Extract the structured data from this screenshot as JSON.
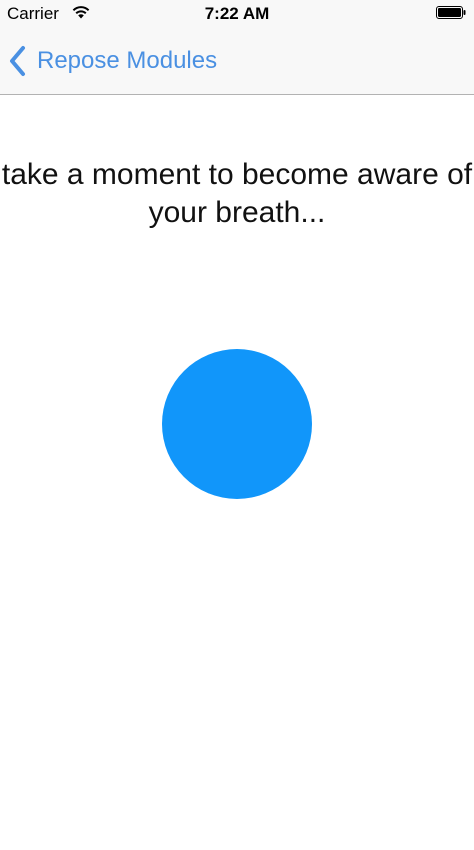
{
  "status_bar": {
    "carrier": "Carrier",
    "time": "7:22 AM",
    "wifi_icon": "wifi-icon",
    "battery_icon": "battery-icon"
  },
  "nav": {
    "back_label": "Repose Modules",
    "back_icon": "chevron-left-icon",
    "accent_color": "#4a90e2"
  },
  "main": {
    "instruction": "take a moment to become aware of your breath...",
    "circle_color": "#1196fa"
  }
}
